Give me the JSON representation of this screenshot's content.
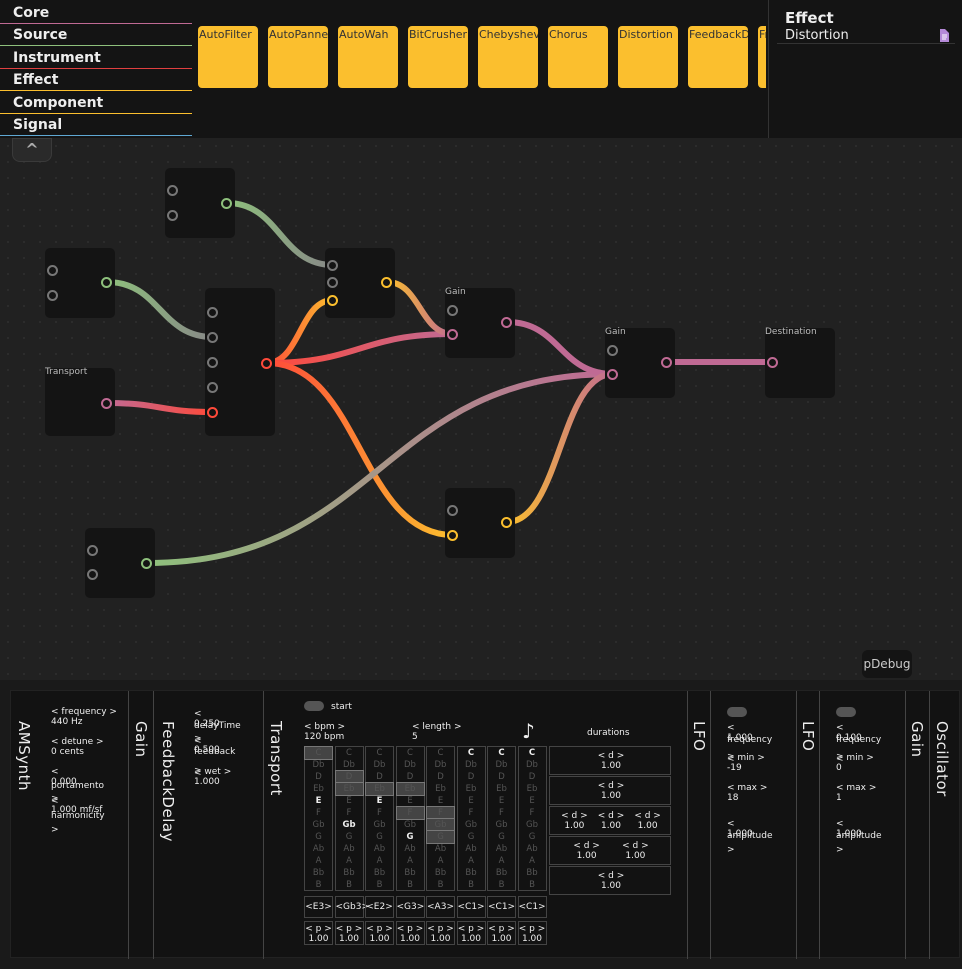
{
  "categories": [
    {
      "label": "Core",
      "color": "#c06a94"
    },
    {
      "label": "Source",
      "color": "#8ec07c"
    },
    {
      "label": "Instrument",
      "color": "#e04040"
    },
    {
      "label": "Effect",
      "color": "#fbbf2e"
    },
    {
      "label": "Component",
      "color": "#fbbf2e"
    },
    {
      "label": "Signal",
      "color": "#5fa8d3"
    }
  ],
  "tiles": [
    "AutoFilter",
    "AutoPanner",
    "AutoWah",
    "BitCrusher",
    "Chebyshev",
    "Chorus",
    "Distortion",
    "FeedbackDelay",
    "FrequencyShifter"
  ],
  "detail": {
    "title": "Effect",
    "item": "Distortion"
  },
  "canvas": {
    "nodes": [
      {
        "id": "n1",
        "label": ""
      },
      {
        "id": "n2",
        "label": ""
      },
      {
        "id": "transport",
        "label": "Transport"
      },
      {
        "id": "n4",
        "label": ""
      },
      {
        "id": "n5",
        "label": ""
      },
      {
        "id": "gain1",
        "label": "Gain"
      },
      {
        "id": "n7",
        "label": ""
      },
      {
        "id": "n8",
        "label": ""
      },
      {
        "id": "gain2",
        "label": "Gain"
      },
      {
        "id": "dest",
        "label": "Destination"
      }
    ],
    "collapse_label": "^",
    "debug_label": "pDebug"
  },
  "modules": {
    "amsynth": {
      "title": "AMSynth",
      "params": [
        {
          "name": "< frequency >",
          "value": "440 Hz"
        },
        {
          "name": "< detune >",
          "value": "0 cents"
        },
        {
          "name": "<",
          "value": "0.000"
        },
        {
          "name": "portamento",
          "value": ""
        },
        {
          "name": "≷",
          "value": "1.000 mf/sf"
        },
        {
          "name": "harmonicity",
          "value": ""
        },
        {
          "name": ">",
          "value": ""
        }
      ]
    },
    "gain": {
      "title": "Gain"
    },
    "feedbackdelay": {
      "title": "FeedbackDelay",
      "params": [
        {
          "name": "<",
          "value": "0.250"
        },
        {
          "name": "delayTime",
          "value": ""
        },
        {
          "name": "≷",
          "value": "0.500"
        },
        {
          "name": "feedback",
          "value": ""
        },
        {
          "name": "≷ wet >",
          "value": "1.000"
        }
      ]
    },
    "transport": {
      "title": "Transport",
      "start": "start",
      "bpm_label": "< bpm >",
      "bpm_value": "120 bpm",
      "length_label": "< length >",
      "length_value": "5",
      "note_icon": "♪",
      "durations_label": "durations",
      "notes": [
        "C",
        "Db",
        "D",
        "Eb",
        "E",
        "F",
        "Gb",
        "G",
        "Ab",
        "A",
        "Bb",
        "B"
      ],
      "note_buttons": [
        "<E3>",
        "<Gb3>",
        "<E2>",
        "<G3>",
        "<A3>",
        "<C1>",
        "<C1>",
        "<C1>"
      ],
      "p_label": "< p >",
      "p_value": "1.00",
      "d_label": "< d >",
      "d_value": "1.00"
    },
    "lfo1": {
      "title": "LFO",
      "params": [
        {
          "name": "<",
          "value": "1.000"
        },
        {
          "name": "frequency",
          "value": ""
        },
        {
          "name": "≷ min >",
          "value": "-19"
        },
        {
          "name": "< max >",
          "value": "18"
        },
        {
          "name": "<",
          "value": "1.000"
        },
        {
          "name": "amplitude",
          "value": ""
        },
        {
          "name": ">",
          "value": ""
        }
      ]
    },
    "lfo2": {
      "title": "LFO",
      "params": [
        {
          "name": "<",
          "value": "0.100"
        },
        {
          "name": "frequency",
          "value": ""
        },
        {
          "name": "≷ min >",
          "value": "0"
        },
        {
          "name": "< max >",
          "value": "1"
        },
        {
          "name": "<",
          "value": "1.000"
        },
        {
          "name": "amplitude",
          "value": ""
        },
        {
          "name": ">",
          "value": ""
        }
      ]
    },
    "gain2": {
      "title": "Gain"
    },
    "oscillator": {
      "title": "Oscillator"
    }
  },
  "icons": {
    "doc": "document-icon",
    "note": "music-note-icon",
    "collapse": "chevron-up-icon"
  }
}
